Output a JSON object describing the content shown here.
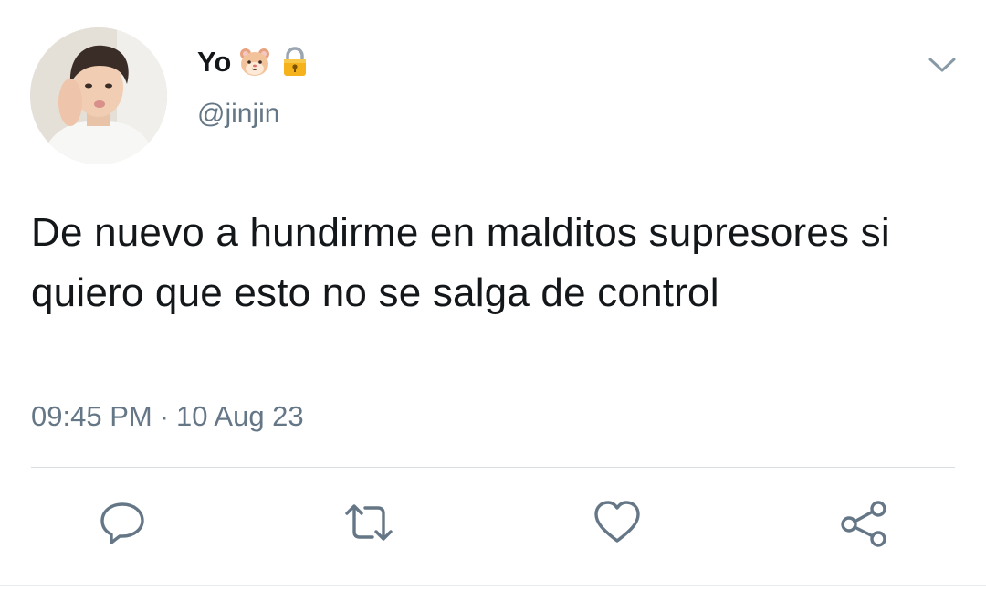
{
  "author": {
    "display_name": "Yo",
    "name_emojis": [
      "hamster-face-emoji",
      "lock-emoji"
    ],
    "handle": "@jinjin"
  },
  "tweet": {
    "text": "De nuevo a hundirme en malditos supresores si quiero que esto no se salga de control",
    "time": "09:45 PM",
    "separator": "·",
    "date": "10 Aug 23"
  },
  "actions": [
    {
      "name": "reply",
      "icon": "speech-bubble-icon"
    },
    {
      "name": "retweet",
      "icon": "retweet-arrows-icon"
    },
    {
      "name": "like",
      "icon": "heart-outline-icon"
    },
    {
      "name": "share",
      "icon": "share-nodes-icon"
    }
  ],
  "colors": {
    "text": "#14171a",
    "secondary": "#657786",
    "icon": "#657786",
    "divider": "#d8dee3"
  }
}
